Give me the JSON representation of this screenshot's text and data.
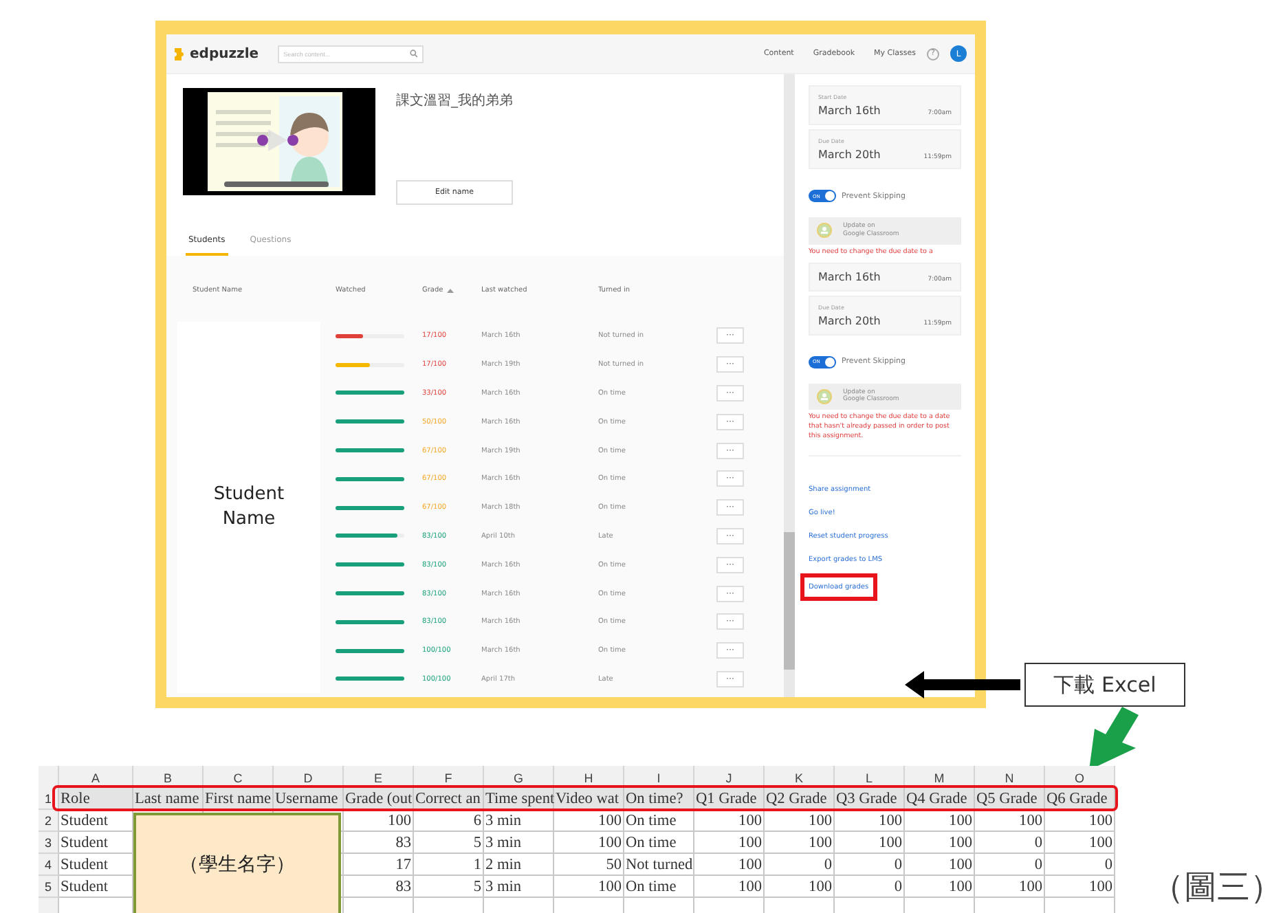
{
  "app": {
    "logo": "edpuzzle",
    "search": {
      "placeholder": "Search content..."
    },
    "nav": [
      "Content",
      "Gradebook",
      "My Classes"
    ],
    "help": "?",
    "avatar": "L"
  },
  "assignment": {
    "title": "課文溫習_我的弟弟",
    "edit_button": "Edit name"
  },
  "tabs": [
    {
      "label": "Students",
      "selected": true
    },
    {
      "label": "Questions",
      "selected": false
    }
  ],
  "table": {
    "columns": [
      "Student Name",
      "Watched",
      "Grade",
      "Last watched",
      "Turned in"
    ],
    "name_overlay": "Student Name",
    "rows": [
      {
        "watched": {
          "level": 0.4,
          "color": "#e0403a"
        },
        "grade": {
          "text": "17/100",
          "color": "#e0403a"
        },
        "last_watched": "March 16th",
        "turned_in": "Not turned in",
        "more": "···"
      },
      {
        "watched": {
          "level": 0.5,
          "color": "#f5b800"
        },
        "grade": {
          "text": "17/100",
          "color": "#e0403a"
        },
        "last_watched": "March 19th",
        "turned_in": "Not turned in",
        "more": "···"
      },
      {
        "watched": {
          "level": 1,
          "color": "#17a07a"
        },
        "grade": {
          "text": "33/100",
          "color": "#e0403a"
        },
        "last_watched": "March 16th",
        "turned_in": "On time",
        "more": "···"
      },
      {
        "watched": {
          "level": 1,
          "color": "#17a07a"
        },
        "grade": {
          "text": "50/100",
          "color": "#f5a623"
        },
        "last_watched": "March 16th",
        "turned_in": "On time",
        "more": "···"
      },
      {
        "watched": {
          "level": 1,
          "color": "#17a07a"
        },
        "grade": {
          "text": "67/100",
          "color": "#f5a623"
        },
        "last_watched": "March 19th",
        "turned_in": "On time",
        "more": "···"
      },
      {
        "watched": {
          "level": 1,
          "color": "#17a07a"
        },
        "grade": {
          "text": "67/100",
          "color": "#f5a623"
        },
        "last_watched": "March 16th",
        "turned_in": "On time",
        "more": "···"
      },
      {
        "watched": {
          "level": 1,
          "color": "#17a07a"
        },
        "grade": {
          "text": "67/100",
          "color": "#f5a623"
        },
        "last_watched": "March 18th",
        "turned_in": "On time",
        "more": "···"
      },
      {
        "watched": {
          "level": 0.9,
          "color": "#17a07a"
        },
        "grade": {
          "text": "83/100",
          "color": "#17a07a"
        },
        "last_watched": "April 10th",
        "turned_in": "Late",
        "more": "···"
      },
      {
        "watched": {
          "level": 1,
          "color": "#17a07a"
        },
        "grade": {
          "text": "83/100",
          "color": "#17a07a"
        },
        "last_watched": "March 16th",
        "turned_in": "On time",
        "more": "···"
      },
      {
        "watched": {
          "level": 1,
          "color": "#17a07a"
        },
        "grade": {
          "text": "83/100",
          "color": "#17a07a"
        },
        "last_watched": "March 16th",
        "turned_in": "On time",
        "more": "···"
      },
      {
        "watched": {
          "level": 1,
          "color": "#17a07a"
        },
        "grade": {
          "text": "83/100",
          "color": "#17a07a"
        },
        "last_watched": "March 16th",
        "turned_in": "On time",
        "more": "···"
      },
      {
        "watched": {
          "level": 1,
          "color": "#17a07a"
        },
        "grade": {
          "text": "100/100",
          "color": "#17a07a"
        },
        "last_watched": "March 16th",
        "turned_in": "On time",
        "more": "···"
      },
      {
        "watched": {
          "level": 1,
          "color": "#17a07a"
        },
        "grade": {
          "text": "100/100",
          "color": "#17a07a"
        },
        "last_watched": "April 17th",
        "turned_in": "Late",
        "more": "···"
      }
    ]
  },
  "sidebar": [
    {
      "kind": "date_card",
      "label": "Start Date",
      "date": "March 16th",
      "time": "7:00am"
    },
    {
      "kind": "date_card",
      "label": "Due Date",
      "date": "March 20th",
      "time": "11:59pm"
    },
    {
      "kind": "toggle",
      "on": true,
      "switch_text": "ON",
      "label": "Prevent Skipping"
    },
    {
      "kind": "classroom_button",
      "line1": "Update on",
      "line2": "Google Classroom"
    },
    {
      "kind": "error",
      "text": "You need to change the due date to a"
    },
    {
      "kind": "date_card",
      "date": "March 16th",
      "time": "7:00am"
    },
    {
      "kind": "date_card",
      "label": "Due Date",
      "date": "March 20th",
      "time": "11:59pm"
    },
    {
      "kind": "toggle",
      "on": true,
      "switch_text": "ON",
      "label": "Prevent Skipping"
    },
    {
      "kind": "classroom_button",
      "line1": "Update on",
      "line2": "Google Classroom"
    },
    {
      "kind": "error",
      "text": "You need to change the due date to a date that hasn't already passed in order to post this assignment."
    },
    {
      "kind": "link",
      "text": "Share assignment",
      "highlighted": false
    },
    {
      "kind": "link",
      "text": "Go live!",
      "highlighted": false
    },
    {
      "kind": "link",
      "text": "Reset student progress",
      "highlighted": false
    },
    {
      "kind": "link",
      "text": "Export grades to LMS",
      "highlighted": false
    },
    {
      "kind": "link",
      "text": "Download grades",
      "highlighted": true
    }
  ],
  "callout": {
    "label": "下載 Excel"
  },
  "spreadsheet": {
    "columns": [
      {
        "letter": "A",
        "kind": "text"
      },
      {
        "letter": "B"
      },
      {
        "letter": "C"
      },
      {
        "letter": "D"
      },
      {
        "letter": "E",
        "kind": "number"
      },
      {
        "letter": "F",
        "kind": "number"
      },
      {
        "letter": "G",
        "kind": "text"
      },
      {
        "letter": "H",
        "kind": "number"
      },
      {
        "letter": "I",
        "kind": "text"
      },
      {
        "letter": "J",
        "kind": "number"
      },
      {
        "letter": "K",
        "kind": "number"
      },
      {
        "letter": "L",
        "kind": "number"
      },
      {
        "letter": "M",
        "kind": "number"
      },
      {
        "letter": "N",
        "kind": "number"
      },
      {
        "letter": "O",
        "kind": "number"
      }
    ],
    "header_highlighted": true,
    "rows": [
      {
        "number": "1",
        "cells": [
          "Role",
          "Last name",
          "First name",
          "Username",
          "Grade (out",
          "Correct an",
          "Time spent",
          "Video wat",
          "On time?",
          "Q1 Grade",
          "Q2 Grade",
          "Q3 Grade",
          "Q4 Grade",
          "Q5 Grade",
          "Q6 Grade"
        ]
      },
      {
        "number": "2",
        "cells": [
          "Student",
          null,
          null,
          null,
          "100",
          "6",
          "3 min",
          "100",
          "On time",
          "100",
          "100",
          "100",
          "100",
          "100",
          "100"
        ]
      },
      {
        "number": "3",
        "cells": [
          "Student",
          null,
          null,
          null,
          "83",
          "5",
          "3 min",
          "100",
          "On time",
          "100",
          "100",
          "100",
          "100",
          "0",
          "100"
        ]
      },
      {
        "number": "4",
        "cells": [
          "Student",
          null,
          null,
          null,
          "17",
          "1",
          "2 min",
          "50",
          "Not turned",
          "100",
          "0",
          "0",
          "100",
          "0",
          "0"
        ]
      },
      {
        "number": "5",
        "cells": [
          "Student",
          null,
          null,
          null,
          "83",
          "5",
          "3 min",
          "100",
          "On time",
          "100",
          "100",
          "0",
          "100",
          "100",
          "100"
        ]
      }
    ],
    "overlay": "（學生名字）"
  },
  "caption": "（圖三）"
}
